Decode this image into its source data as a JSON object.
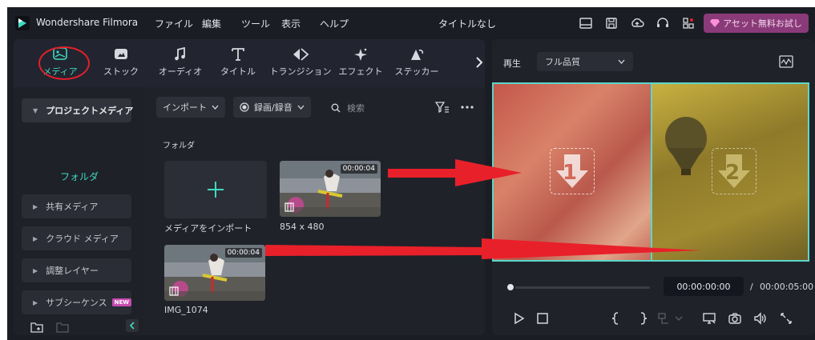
{
  "app": {
    "name": "Wondershare Filmora",
    "menus": [
      "ファイル",
      "編集",
      "ツール",
      "表示",
      "ヘルプ"
    ],
    "project_title": "タイトルなし",
    "asset_button": "アセット無料お試し"
  },
  "tabs": [
    {
      "label": "メディア",
      "icon": "media-icon",
      "active": true
    },
    {
      "label": "ストック",
      "icon": "stock-icon"
    },
    {
      "label": "オーディオ",
      "icon": "music-note-icon"
    },
    {
      "label": "タイトル",
      "icon": "text-t-icon"
    },
    {
      "label": "トランジション",
      "icon": "transition-icon"
    },
    {
      "label": "エフェクト",
      "icon": "effect-star-icon"
    },
    {
      "label": "ステッカー",
      "icon": "sticker-icon"
    }
  ],
  "sidebar": {
    "project_media": "プロジェクトメディア",
    "folder": "フォルダ",
    "shared_media": "共有メディア",
    "cloud_media": "クラウド メディア",
    "adjustment_layer": "調整レイヤー",
    "subsequence": "サブシーケンス",
    "new_badge": "NEW"
  },
  "media_toolbar": {
    "import": "インポート",
    "record": "録画/録音",
    "search_placeholder": "検索"
  },
  "media": {
    "folder_heading": "フォルダ",
    "import_tile_label": "メディアをインポート",
    "clips": [
      {
        "name": "854 x 480",
        "duration": "00:00:04"
      },
      {
        "name": "IMG_1074",
        "duration": "00:00:04"
      }
    ]
  },
  "player": {
    "play_label": "再生",
    "quality": "フル品質",
    "slot_numbers": [
      "1",
      "2"
    ],
    "current_time": "00:00:00:00",
    "separator": "/",
    "total_time": "00:00:05:00",
    "progress": 0
  },
  "colors": {
    "accent": "#3ed9c0",
    "annotation_red": "#e0202a"
  }
}
